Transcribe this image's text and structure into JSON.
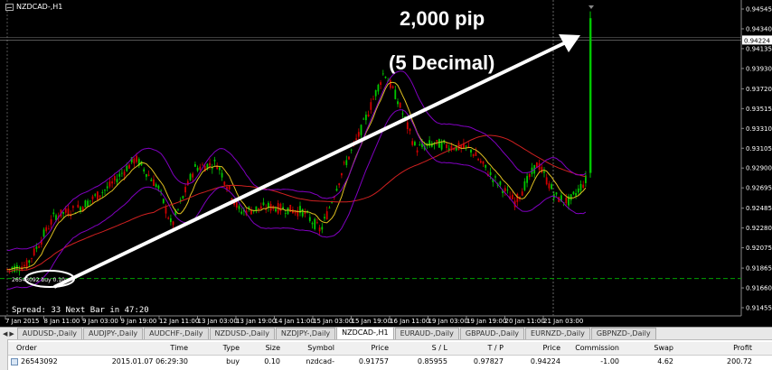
{
  "window": {
    "title": "NZDCAD-,H1"
  },
  "annotations": {
    "pips": "2,000 pip",
    "decimal": "(5 Decimal)",
    "trade_label": "26543092 buy 0.10"
  },
  "status": {
    "spread": "Spread: 33 Next Bar in 47:20"
  },
  "price_axis": {
    "labels": [
      "0.94545",
      "0.94340",
      "0.94224",
      "0.94135",
      "0.93930",
      "0.93720",
      "0.93515",
      "0.93310",
      "0.93105",
      "0.92900",
      "0.92695",
      "0.92485",
      "0.92280",
      "0.92075",
      "0.91865",
      "0.91660",
      "0.91455"
    ],
    "current_price": "0.94224"
  },
  "time_axis": {
    "labels": [
      "7 Jan 2015",
      "8 Jan 11:00",
      "9 Jan 03:00",
      "9 Jan 19:00",
      "12 Jan 11:00",
      "13 Jan 03:00",
      "13 Jan 19:00",
      "14 Jan 11:00",
      "15 Jan 03:00",
      "15 Jan 19:00",
      "16 Jan 11:00",
      "19 Jan 03:00",
      "19 Jan 19:00",
      "20 Jan 11:00",
      "21 Jan 03:00"
    ]
  },
  "tabs": [
    "AUDUSD-,Daily",
    "AUDJPY-,Daily",
    "AUDCHF-,Daily",
    "NZDUSD-,Daily",
    "NZDJPY-,Daily",
    "NZDCAD-,H1",
    "EURAUD-,Daily",
    "GBPAUD-,Daily",
    "EURNZD-,Daily",
    "GBPNZD-,Daily"
  ],
  "active_tab": "NZDCAD-,H1",
  "terminal": {
    "columns": [
      "Order",
      "Time",
      "Type",
      "Size",
      "Symbol",
      "Price",
      "S / L",
      "T / P",
      "Price",
      "Commission",
      "Swap",
      "Profit"
    ],
    "row": [
      "26543092",
      "2015.01.07 06:29:30",
      "buy",
      "0.10",
      "nzdcad-",
      "0.91757",
      "0.85955",
      "0.97827",
      "0.94224",
      "-1.00",
      "4.62",
      "200.72"
    ]
  },
  "colors": {
    "bull": "#00c800",
    "bear": "#d00000",
    "bands": "#8000c0",
    "ma_fast": "#e0c020",
    "ma_slow": "#d02020",
    "arrow": "#ffffff",
    "entry_line": "#00a000"
  }
}
